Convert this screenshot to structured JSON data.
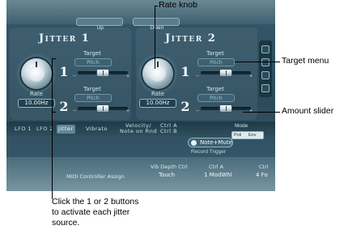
{
  "topbar": {
    "up_label": "Up",
    "down_label": "Down"
  },
  "jitter1": {
    "title": "Jitter 1",
    "rate_label": "Rate",
    "rate_value": "10.00Hz",
    "source1": {
      "number": "1",
      "target_label": "Target",
      "target_value": "Pitch",
      "amount": 0.5
    },
    "source2": {
      "number": "2",
      "target_label": "Target",
      "target_value": "Pitch",
      "amount": 0.5
    }
  },
  "jitter2": {
    "title": "Jitter 2",
    "rate_label": "Rate",
    "rate_value": "10.00Hz",
    "source1": {
      "number": "1",
      "target_label": "Target",
      "target_value": "Pitch",
      "amount": 0.5
    },
    "source2": {
      "number": "2",
      "target_label": "Target",
      "target_value": "Pitch",
      "amount": 0.5
    }
  },
  "tabs": [
    {
      "label": "LFO 1",
      "active": false
    },
    {
      "label": "LFO 2",
      "active": false
    },
    {
      "label": "Jitter",
      "active": true
    },
    {
      "label": "Vibrato",
      "active": false
    },
    {
      "label": "Velocity/\nNote on Rnd",
      "active": false
    },
    {
      "label": "Ctrl A\nCtrl B",
      "active": false
    }
  ],
  "mode": {
    "label": "Mode",
    "option_a": "Poli",
    "option_b": "Env"
  },
  "note_mute": {
    "label": "Note+Mute",
    "record_trigger": "Record Trigger"
  },
  "controller": {
    "midi_assign": "MIDI Controller Assign",
    "vib_depth_label": "Vib Depth Ctrl",
    "vib_depth_value": "Touch",
    "ctrl_a_label": "Ctrl A",
    "ctrl_a_value": "1 ModWhl",
    "ctrl_b_label": "Ctrl",
    "ctrl_b_value": "4 Fo"
  },
  "callouts": {
    "rate_knob": "Rate knob",
    "target_menu": "Target menu",
    "amount_slider": "Amount slider",
    "click_buttons": "Click the 1 or 2 buttons\nto activate each jitter\nsource."
  },
  "colors": {
    "panel": "#2b4b5c",
    "accent": "#8fb9c9",
    "tab_active": "#5f8798"
  }
}
